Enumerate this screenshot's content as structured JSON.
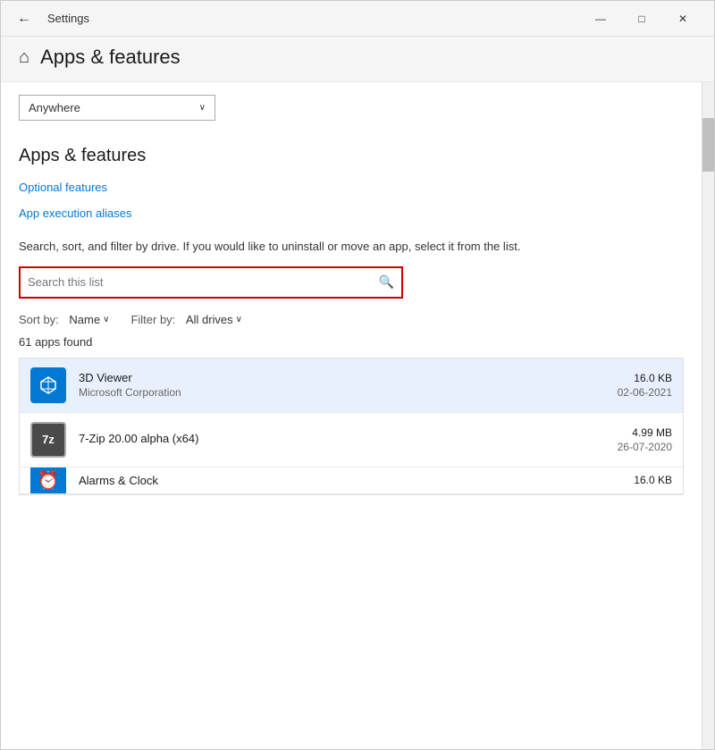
{
  "titleBar": {
    "title": "Settings",
    "backArrow": "←",
    "minimizeLabel": "—",
    "maximizeLabel": "□",
    "closeLabel": "✕"
  },
  "pageHeader": {
    "icon": "⌂",
    "title": "Apps & features"
  },
  "anywhereDropdown": {
    "value": "Anywhere",
    "chevron": "∨"
  },
  "sectionTitle": "Apps & features",
  "links": {
    "optionalFeatures": "Optional features",
    "appExecutionAliases": "App execution aliases"
  },
  "description": "Search, sort, and filter by drive. If you would like to uninstall or move an app, select it from the list.",
  "searchBox": {
    "placeholder": "Search this list",
    "iconSymbol": "🔍"
  },
  "sortFilter": {
    "sortLabel": "Sort by:",
    "sortValue": "Name",
    "sortChevron": "∨",
    "filterLabel": "Filter by:",
    "filterValue": "All drives",
    "filterChevron": "∨"
  },
  "appsCount": "61 apps found",
  "apps": [
    {
      "name": "3D Viewer",
      "publisher": "Microsoft Corporation",
      "size": "16.0 KB",
      "date": "02-06-2021",
      "iconType": "3d",
      "iconText": "⬡"
    },
    {
      "name": "7-Zip 20.00 alpha (x64)",
      "publisher": "",
      "size": "4.99 MB",
      "date": "26-07-2020",
      "iconType": "7zip",
      "iconText": "7z"
    },
    {
      "name": "Alarms & Clock",
      "publisher": "",
      "size": "16.0 KB",
      "date": "",
      "iconType": "alarms",
      "iconText": "⏰",
      "partial": true
    }
  ],
  "colors": {
    "accent": "#0078d4",
    "searchBorder": "#cc0000",
    "linkColor": "#0078d4"
  }
}
